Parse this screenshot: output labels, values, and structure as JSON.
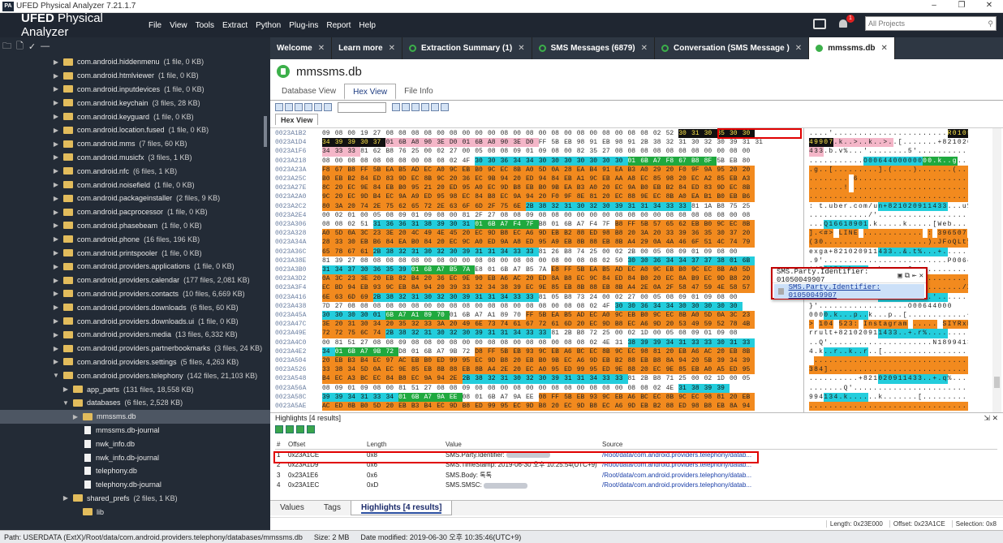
{
  "window": {
    "title": "UFED Physical Analyzer 7.21.1.7",
    "logo": "PA",
    "controls": [
      "–",
      "❐",
      "✕"
    ]
  },
  "header": {
    "brand_bold": "UFED",
    "brand_rest": "Physical Analyzer",
    "menu": [
      "File",
      "View",
      "Tools",
      "Extract",
      "Python",
      "Plug-ins",
      "Report",
      "Help"
    ],
    "notification_count": "1",
    "search_placeholder": "All Projects",
    "search_icon": "search-icon"
  },
  "sidebar": {
    "tools": [
      "🗀",
      "🗋",
      "✓",
      "—"
    ],
    "items": [
      {
        "name": "com.android.hiddenmenu",
        "count": "(1 file, 0 KB)"
      },
      {
        "name": "com.android.htmlviewer",
        "count": "(1 file, 0 KB)"
      },
      {
        "name": "com.android.inputdevices",
        "count": "(1 file, 0 KB)"
      },
      {
        "name": "com.android.keychain",
        "count": "(3 files, 28 KB)"
      },
      {
        "name": "com.android.keyguard",
        "count": "(1 file, 0 KB)"
      },
      {
        "name": "com.android.location.fused",
        "count": "(1 file, 0 KB)"
      },
      {
        "name": "com.android.mms",
        "count": "(7 files, 60 KB)"
      },
      {
        "name": "com.android.musicfx",
        "count": "(3 files, 1 KB)"
      },
      {
        "name": "com.android.nfc",
        "count": "(6 files, 1 KB)"
      },
      {
        "name": "com.android.noisefield",
        "count": "(1 file, 0 KB)"
      },
      {
        "name": "com.android.packageinstaller",
        "count": "(2 files, 9 KB)"
      },
      {
        "name": "com.android.pacprocessor",
        "count": "(1 file, 0 KB)"
      },
      {
        "name": "com.android.phasebeam",
        "count": "(1 file, 0 KB)"
      },
      {
        "name": "com.android.phone",
        "count": "(16 files, 196 KB)"
      },
      {
        "name": "com.android.printspooler",
        "count": "(1 file, 0 KB)"
      },
      {
        "name": "com.android.providers.applications",
        "count": "(1 file, 0 KB)"
      },
      {
        "name": "com.android.providers.calendar",
        "count": "(177 files, 2,081 KB)"
      },
      {
        "name": "com.android.providers.contacts",
        "count": "(10 files, 6,669 KB)"
      },
      {
        "name": "com.android.providers.downloads",
        "count": "(6 files, 60 KB)"
      },
      {
        "name": "com.android.providers.downloads.ui",
        "count": "(1 file, 0 KB)"
      },
      {
        "name": "com.android.providers.media",
        "count": "(13 files, 6,332 KB)"
      },
      {
        "name": "com.android.providers.partnerbookmarks",
        "count": "(3 files, 24 KB)"
      },
      {
        "name": "com.android.providers.settings",
        "count": "(5 files, 4,263 KB)"
      },
      {
        "name": "com.android.providers.telephony",
        "count": "(142 files, 21,103 KB)"
      },
      {
        "name": "app_parts",
        "count": "(131 files, 18,558 KB)"
      },
      {
        "name": "databases",
        "count": "(6 files, 2,528 KB)"
      },
      {
        "name": "mmssms.db",
        "count": ""
      },
      {
        "name": "mmssms.db-journal",
        "count": ""
      },
      {
        "name": "nwk_info.db",
        "count": ""
      },
      {
        "name": "nwk_info.db-journal",
        "count": ""
      },
      {
        "name": "telephony.db",
        "count": ""
      },
      {
        "name": "telephony.db-journal",
        "count": ""
      },
      {
        "name": "shared_prefs",
        "count": "(2 files, 1 KB)"
      },
      {
        "name": "lib",
        "count": ""
      }
    ]
  },
  "tabs": [
    {
      "label": "Welcome"
    },
    {
      "label": "Learn more"
    },
    {
      "label": "Extraction Summary (1)"
    },
    {
      "label": "SMS Messages (6879)"
    },
    {
      "label": "Conversation (SMS Message )"
    },
    {
      "label": "mmssms.db"
    }
  ],
  "db_title": "mmssms.db",
  "subtabs": [
    "Database View",
    "Hex View",
    "File Info"
  ],
  "hex_tab_label": "Hex View",
  "hex": {
    "addresses": [
      "0023A1B2",
      "0023A1D4",
      "0023A1F6",
      "0023A218",
      "0023A23A",
      "0023A25C",
      "0023A27E",
      "0023A2A0",
      "0023A2C2",
      "0023A2E4",
      "0023A306",
      "0023A328",
      "0023A34A",
      "0023A36C",
      "0023A38E",
      "0023A3B0",
      "0023A3D2",
      "0023A3F4",
      "0023A416",
      "0023A438",
      "0023A45A",
      "0023A47C",
      "0023A49E",
      "0023A4C0",
      "0023A4E2",
      "0023A504",
      "0023A526",
      "0023A548",
      "0023A56A",
      "0023A58C",
      "0023A5AE"
    ],
    "rows": [
      "09 08 00 19 27 08 08 08 08 00 08 00 00 00 08 00 08 00 08 00 08 00 08 00 08 08 02 52 30 31 30 35 30 30",
      "34 39 39 30 37 01 6B A8 90 3E D0 01 6B A8 90 3E D0 FF 5B EB 98 91 EB 98 91 2B 38 32 31 30 32 30 39 31 31",
      "34 33 33 81 62 B8 76 25 00 02 27 00 05 08 08 09 01 09 08 00 82 35 27 08 08 08 08 08 08 08 00 00 08 00",
      "08 00 08 08 08 08 08 00 08 08 02 4F 30 30 36 34 34 30 30 30 30 30 30 30 01 6B A7 F8 67 B8 8F 5B EB 80",
      "F8 67 B8 FF 5B EA B5 AD EC A0 9C EB B0 9C EC 8B A0 5D 0A 28 EA B4 91 EA B3 A0 29 20 F0 9F 9A 95 20 20",
      "B0 EB B2 84 ED 83 9D EC 8B 9C 20 36 EC 9B 94 20 ED 94 84 EB A1 9C EB AA A8 EC 85 98 20 EC A2 85 EB A3",
      "8C 20 EC 9E 84 EB B0 95 21 20 ED 95 A0 EC 9D B8 EB B0 9B EA B3 A0 20 EC 9A B0 EB B2 84 ED 83 9D EC 8B",
      "9C 20 EC 9D B4 EC 9A A9 ED 95 98 EC 84 B8 EC 9A 94 20 F0 9F 8E 81 20 EC 88 9E EC 8B A0 EA B1 B0 EB B6",
      "80 3A 20 74 2E 75 62 65 72 2E 63 6F 6D 2F 75 6E 2B 38 32 31 30 32 30 39 31 31 34 33 33 81 1A B8 75 25",
      "00 02 01 00 05 08 09 01 09 08 00 81 2F 27 08 08 09 08 08 00 00 00 00 08 08 00 00 08 08 08 08 08 00 08",
      "08 08 02 51 31 36 36 31 38 39 30 31 01 6B A7 F4 7F B8 01 6B A7 F4 7F B8 FF 5B 57 65 62 EB B0 9C EC 8B",
      "A0 5D 0A 3C 23 3E 20 4C 49 4E 45 20 EC 9D B8 EC A6 9D EB B2 88 ED 98 B8 20 3A 20 33 39 36 35 30 37 20",
      "28 33 30 EB B6 84 EA B0 84 20 EC 9C A0 ED 9A A8 ED 95 A9 EB 8B 88 EB 8B A4 29 0A 4A 46 6F 51 4C 74 79",
      "65 78 67 61 2B 38 32 31 30 32 30 39 31 31 34 33 33 81 26 B8 74 25 00 02 2B 00 05 08 09 01 09 08 00",
      "81 39 27 08 08 08 08 08 00 08 00 00 08 08 00 08 08 00 08 00 08 08 02 50 30 30 36 34 34 37 37 38 01 6B",
      "31 34 37 30 36 35 39 01 6B A7 B5 7A E8 01 6B A7 B5 7A E8 FF 5B EA B5 AD EC A0 9C EB B0 9C EC 8B A0 5D",
      "0A 3C 23 3E 20 EB 82 B4 20 36 EC 9E 90 EB A6 AC 20 ED 8A B8 EC 9C 84 ED 84 B0 20 EC 8A B9 EC 9D B8 20",
      "EC BD 94 EB 93 9C EB 8A 94 20 39 33 32 34 38 39 EC 9E 85 EB 8B 88 EB 8B A4 2E 0A 2F 58 47 59 4E 58 57",
      "6E 63 6D 69 2B 38 32 31 30 32 30 39 31 31 34 33 33 81 05 B8 73 24 00 02 27 00 05 08 09 01 09 08 00",
      "7D 27 08 08 08 08 00 08 00 00 08 08 00 08 08 00 08 08 00 08 08 02 4F 30 30 36 34 34 30 30 30 30 30",
      "30 30 30 30 01 6B A7 A1 89 70 01 6B A7 A1 89 70 FF 5B EA B5 AD EC A0 9C EB B0 9C EC 8B A0 5D 0A 3C 23",
      "3E 20 31 30 34 20 35 32 33 3A 20 49 6E 73 74 61 67 72 61 6D 20 EC 9D B8 EC A6 9D 20 53 49 59 52 78 4B",
      "72 72 75 6C 74 2B 38 32 31 30 32 30 39 31 31 34 33 33 81 2B B8 72 25 00 02 1D 00 05 08 09 01 09 08",
      "00 81 51 27 08 08 09 08 08 00 08 00 00 08 08 00 08 08 00 08 08 02 4E 31 38 39 39 34 31 33 33 30 31 33",
      "34 01 6B A7 9B 72 D8 01 6B A7 9B 72 D8 FF 5B EB 93 9C EB A6 BC EC 8B 9C EC 98 81 20 EB A6 AC 20 EB 8B",
      "20 EB B3 B4 EC 97 AC EB B0 ED 99 95 EC 9D B8 20 EB B0 9B EC A6 9D EB B2 88 EB B8 8A 94 20 5B 39 34 39",
      "33 38 34 5D 0A EC 9E 85 EB 8B 88 EB 8B A4 2E 20 EC A0 95 ED 99 95 ED 9E 88 20 EC 9E 85 EB A0 A5 ED 95",
      "B4 EC A3 BC EC 84 B8 EC 9A 94 2E 2B 38 32 31 30 32 30 39 31 31 34 33 33 81 2B B8 71 25 00 02 1D 00 05",
      "08 09 01 09 08 00 81 51 27 08 08 09 08 08 00 08 00 00 08 08 00 08 08 00 08 08 02 4E 31 38 39 39",
      "39 39 34 31 33 34 01 6B A7 9A EE 08 01 6B A7 9A EE 08 FF 5B EB 93 9C EB A6 BC EC 8B 9C EC 98 81 20 EB",
      "AC ED 8B B0 5D 20 EB B3 B4 EC 9D B8 ED 99 95 EC 9D B8 20 EC 9D B8 EC A6 9D EB B2 88 ED 98 B8 EB 8A 94"
    ],
    "ascii": [
      "....'.......................R010500",
      "49907.k..>..k..>..[.......+821020911",
      "433.b.v%...'........5'..............",
      "...........O0064400000000.k..g..[...",
      ".g..[.........].(....).......(....",
      "........ 6............................",
      ".......! .........................",
      ".......................................",
      ": t.uber.com/un+821020911433...u%",
      "............/'..........................",
      "...Q16618901.k.....k.....[Web.....",
      "].<#> LINE ............ : 396507 ",
      "(30.....................).JFoQLty",
      "exga+821020911433..&.t%...+.......",
      ".9'.........................P00644778",
      "1470659.k..z..k..z..[...........",
      ".<#> ... 6.........................",
      "......... 932489.............../XGYNXW",
      "ncmi+821020911433...s$...'........",
      "}'..................O00644000",
      "0000.k...p..k...p..[............<#",
      "> 104 523: Instagram ..... SIYRxK",
      "rrult+821020911433..+.r%..........",
      "..Q'.....................N1899413",
      "4.k..r..k..r..[.................",
      " ..................................[949",
      "384]..............................",
      "..........+821020911433..+.q%......",
      ".......Q'...........................N18",
      "994134.k......k.......[...............",
      "........................................"
    ]
  },
  "tooltip": {
    "title": "SMS.Party.Identifier: 01050049907",
    "link": "SMS.Party.Identifier: 01050049907",
    "icons": [
      "▣",
      "⧉",
      "⇤",
      "✕"
    ]
  },
  "highlights": {
    "title": "Highlights [4 results]",
    "pin": "⇲ ✕",
    "headers": [
      "#",
      "Offset",
      "Length",
      "Value",
      "Source"
    ],
    "rows": [
      [
        "1",
        "0x23A1CE",
        "0x8",
        "SMS.Party.Identifier:",
        "/Root/data/com.android.providers.telephony/datab..."
      ],
      [
        "2",
        "0x23A1D9",
        "0x6",
        "SMS.TimeStamp: 2019-06-30 오후 10:25:54(UTC+9)",
        "/Root/data/com.android.providers.telephony/datab..."
      ],
      [
        "3",
        "0x23A1E6",
        "0x6",
        "SMS.Body: 톡톡",
        "/Root/data/com.android.providers.telephony/datab..."
      ],
      [
        "4",
        "0x23A1EC",
        "0xD",
        "SMS.SMSC:",
        "/Root/data/com.android.providers.telephony/datab..."
      ]
    ]
  },
  "bottom_tabs": [
    "Values",
    "Tags",
    "Highlights [4 results]"
  ],
  "status_right": {
    "length": "Length: 0x23E000",
    "offset": "Offset: 0x23A1CE",
    "selection": "Selection: 0x8"
  },
  "status_bar": {
    "path": "Path: USERDATA (ExtX)/Root/data/com.android.providers.telephony/databases/mmssms.db",
    "size": "Size: 2 MB",
    "modified": "Date modified: 2019-06-30 오후 10:35:46(UTC+9)"
  },
  "colors": {
    "accent_green": "#3cb04a",
    "header_bg": "#1f2631",
    "sidebar_bg": "#232b36",
    "highlight_red": "#e00000",
    "orange": "#f28a1e",
    "cyan": "#23cddc",
    "green": "#1fa93e"
  }
}
